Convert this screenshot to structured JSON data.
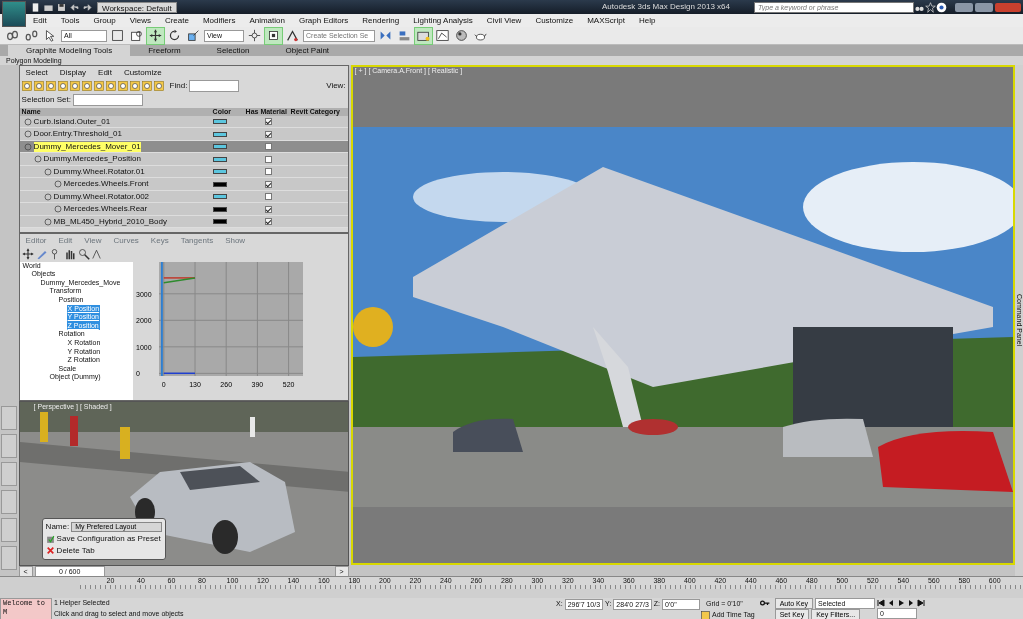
{
  "title_bar": {
    "workspace": "Workspace: Default",
    "title": "Autodesk 3ds Max Design 2013 x64",
    "search": {
      "placeholder": "Type a keyword or phrase"
    }
  },
  "menu": [
    "Edit",
    "Tools",
    "Group",
    "Views",
    "Create",
    "Modifiers",
    "Animation",
    "Graph Editors",
    "Rendering",
    "Lighting Analysis",
    "Civil View",
    "Customize",
    "MAXScript",
    "Help"
  ],
  "main_toolbar": {
    "filter": "All",
    "coordinate_system": "View",
    "selection_set": {
      "placeholder": "Create Selection Se"
    },
    "tools": [
      {
        "kind": "link",
        "selected": false
      },
      {
        "kind": "unlink",
        "selected": false
      },
      {
        "kind": "select",
        "selected": false
      },
      {
        "kind": "region",
        "selected": false
      },
      {
        "kind": "window",
        "selected": false
      },
      {
        "kind": "move",
        "selected": true
      },
      {
        "kind": "rotate",
        "selected": false
      },
      {
        "kind": "scale",
        "selected": false
      },
      {
        "kind": "pivot",
        "selected": false
      },
      {
        "kind": "snap",
        "selected": true
      },
      {
        "kind": "angle",
        "selected": false
      },
      {
        "kind": "mirror",
        "selected": false
      },
      {
        "kind": "align",
        "selected": false
      },
      {
        "kind": "explorer",
        "selected": true
      },
      {
        "kind": "curve",
        "selected": false
      },
      {
        "kind": "material",
        "selected": false
      },
      {
        "kind": "teapot",
        "selected": false
      }
    ]
  },
  "ribbon": {
    "tabs": [
      {
        "label": "Graphite Modeling Tools",
        "selected": true
      },
      {
        "label": "Freeform",
        "selected": false
      },
      {
        "label": "Selection",
        "selected": false
      },
      {
        "label": "Object Paint",
        "selected": false
      }
    ],
    "panel": "Polygon Modeling"
  },
  "scene_explorer": {
    "menu": [
      "Select",
      "Display",
      "Edit",
      "Customize"
    ],
    "find_label": "Find:",
    "view_label": "View:",
    "selection_set_label": "Selection Set:",
    "columns": [
      "Name",
      "Color",
      "Has Material",
      "Revit Category"
    ],
    "rows": [
      {
        "name": "Curb.Island.Outer_01",
        "color": "#5cc6df",
        "has_material": true,
        "selected": false,
        "children": []
      },
      {
        "name": "Door.Entry.Threshold_01",
        "color": "#5cc6df",
        "has_material": true,
        "selected": false,
        "children": []
      },
      {
        "name": "Dummy_Mercedes_Mover_01",
        "color": "#5cc6df",
        "has_material": false,
        "selected": true,
        "children": [
          {
            "name": "Dummy.Mercedes_Position",
            "color": "#5cc6df",
            "has_material": false,
            "selected": false,
            "children": [
              {
                "name": "Dummy.Wheel.Rotator.01",
                "color": "#5cc6df",
                "has_material": false,
                "selected": false,
                "children": [
                  {
                    "name": "Mercedes.Wheels.Front",
                    "color": "#000000",
                    "has_material": true,
                    "selected": false
                  }
                ]
              },
              {
                "name": "Dummy.Wheel.Rotator.002",
                "color": "#5cc6df",
                "has_material": false,
                "selected": false,
                "children": [
                  {
                    "name": "Mercedes.Wheels.Rear",
                    "color": "#000000",
                    "has_material": true,
                    "selected": false
                  }
                ]
              },
              {
                "name": "MB_ML450_Hybrid_2010_Body",
                "color": "#000000",
                "has_material": true,
                "selected": false
              }
            ]
          }
        ]
      }
    ]
  },
  "curve_editor": {
    "menu": [
      "Editor",
      "Edit",
      "View",
      "Curves",
      "Keys",
      "Tangents",
      "Show"
    ],
    "tree": [
      {
        "label": "World",
        "selected": false,
        "children": [
          {
            "label": "Objects",
            "selected": false,
            "children": [
              {
                "label": "Dummy_Mercedes_Move",
                "selected": false,
                "children": [
                  {
                    "label": "Transform",
                    "selected": false,
                    "children": [
                      {
                        "label": "Position",
                        "selected": false,
                        "children": [
                          {
                            "label": "X Position",
                            "selected": true
                          },
                          {
                            "label": "Y Position",
                            "selected": true
                          },
                          {
                            "label": "Z Position",
                            "selected": true
                          }
                        ]
                      },
                      {
                        "label": "Rotation",
                        "selected": false,
                        "children": [
                          {
                            "label": "X Rotation",
                            "selected": false
                          },
                          {
                            "label": "Y Rotation",
                            "selected": false
                          },
                          {
                            "label": "Z Rotation",
                            "selected": false
                          }
                        ]
                      },
                      {
                        "label": "Scale",
                        "selected": false
                      }
                    ]
                  },
                  {
                    "label": "Object (Dummy)",
                    "selected": false
                  }
                ]
              }
            ]
          }
        ]
      }
    ],
    "chart_data": {
      "type": "line",
      "grid": true,
      "x": [
        0,
        130
      ],
      "series": [
        {
          "color": "#c0392b",
          "values": [
            3600,
            3600
          ]
        },
        {
          "color": "#2e8b2e",
          "values": [
            3420,
            3600
          ]
        },
        {
          "color": "#1f3fd0",
          "values": [
            0,
            0
          ]
        }
      ],
      "ref_lines": [
        {
          "axis": "x",
          "value": -8,
          "color": "#2f7fd0"
        }
      ],
      "xlim": [
        -20,
        580
      ],
      "ylim": [
        -100,
        4200
      ],
      "xticks": [
        0,
        130,
        260,
        390,
        520
      ],
      "yticks": [
        0,
        1000,
        2000,
        3000
      ]
    }
  },
  "perspective_viewport": {
    "label": "[ Perspective ] [ Shaded ]",
    "kind": "picture",
    "popup": {
      "name_label": "Name:",
      "name_value": "My Prefered Layout",
      "items": [
        {
          "kind": "save",
          "label": "Save Configuration as Preset"
        },
        {
          "kind": "delete",
          "label": "Delete Tab"
        }
      ]
    }
  },
  "time_slider": {
    "prev": "<",
    "position": "0 / 600",
    "next": ">"
  },
  "camera_viewport": {
    "label": "[ + ] [ Camera.A.Front ] [ Realistic ]",
    "kind": "picture"
  },
  "command_panel": {
    "label": "Command Panel"
  },
  "timeline": {
    "labels": [
      "20",
      "40",
      "60",
      "80",
      "100",
      "120",
      "140",
      "160",
      "180",
      "200",
      "220",
      "240",
      "260",
      "280",
      "300",
      "320",
      "340",
      "360",
      "380",
      "400",
      "420",
      "440",
      "460",
      "480",
      "500",
      "520",
      "540",
      "560",
      "580",
      "600"
    ]
  },
  "status_bar": {
    "listener": "Welcome to M",
    "selection": "1 Helper Selected",
    "prompt": "Click and drag to select and move objects",
    "x_label": "X:",
    "x": "296'7 10/3",
    "y_label": "Y:",
    "y": "284'0 27/3",
    "z_label": "Z:",
    "z": "0'0\"",
    "grid": "Grid = 0'10\"",
    "add_time_tag": "Add Time Tag",
    "auto_key": "Auto Key",
    "key_mode": "Selected",
    "set_key": "Set Key",
    "key_filters": "Key Filters...",
    "frame": "0"
  }
}
